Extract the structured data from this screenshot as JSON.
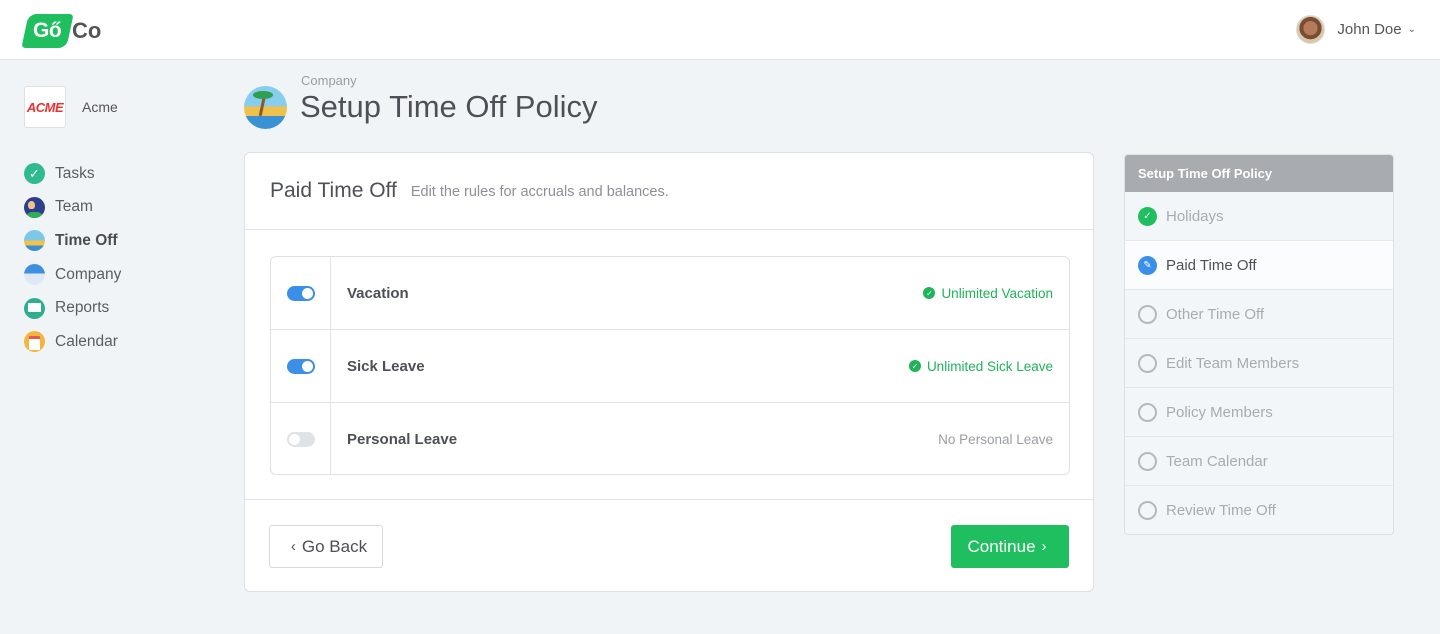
{
  "header": {
    "logo": {
      "go": "Gő",
      "co": "Co"
    },
    "user": {
      "name": "John Doe",
      "caret": "⌄"
    }
  },
  "sidebar": {
    "org": {
      "logo_text": "ACME",
      "name": "Acme"
    },
    "items": [
      {
        "label": "Tasks",
        "icon": "check-circle-icon",
        "active": false
      },
      {
        "label": "Team",
        "icon": "team-icon",
        "active": false
      },
      {
        "label": "Time Off",
        "icon": "beach-icon",
        "active": true
      },
      {
        "label": "Company",
        "icon": "building-icon",
        "active": false
      },
      {
        "label": "Reports",
        "icon": "presentation-icon",
        "active": false
      },
      {
        "label": "Calendar",
        "icon": "calendar-icon",
        "active": false
      }
    ]
  },
  "page": {
    "breadcrumb": "Company",
    "title": "Setup Time Off Policy"
  },
  "card": {
    "title": "Paid Time Off",
    "subtitle": "Edit the rules for accruals and balances.",
    "policies": [
      {
        "name": "Vacation",
        "enabled": true,
        "status": "Unlimited Vacation",
        "status_type": "ok"
      },
      {
        "name": "Sick Leave",
        "enabled": true,
        "status": "Unlimited Sick Leave",
        "status_type": "ok"
      },
      {
        "name": "Personal Leave",
        "enabled": false,
        "status": "No Personal Leave",
        "status_type": "none"
      }
    ],
    "back_label": "Go Back",
    "continue_label": "Continue"
  },
  "steps": {
    "title": "Setup Time Off Policy",
    "items": [
      {
        "label": "Holidays",
        "state": "done"
      },
      {
        "label": "Paid Time Off",
        "state": "current"
      },
      {
        "label": "Other Time Off",
        "state": "todo"
      },
      {
        "label": "Edit Team Members",
        "state": "todo"
      },
      {
        "label": "Policy Members",
        "state": "todo"
      },
      {
        "label": "Team Calendar",
        "state": "todo"
      },
      {
        "label": "Review Time Off",
        "state": "todo"
      }
    ]
  },
  "colors": {
    "brand_green": "#1fbf5f",
    "toggle_blue": "#3b8fe8",
    "status_green": "#1fb35a",
    "background": "#f1f4f7"
  }
}
